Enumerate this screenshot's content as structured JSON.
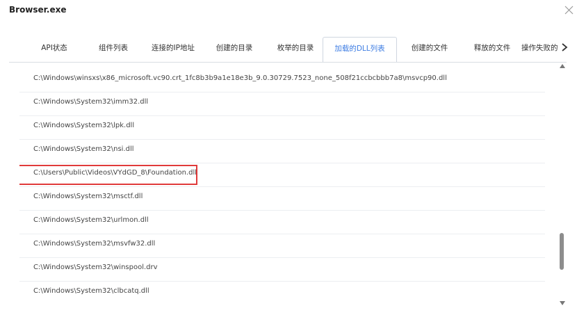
{
  "window": {
    "title": "Browser.exe"
  },
  "tabs": [
    {
      "label": "API状态"
    },
    {
      "label": "组件列表"
    },
    {
      "label": "连接的IP地址"
    },
    {
      "label": "创建的目录"
    },
    {
      "label": "枚举的目录"
    },
    {
      "label": "加载的DLL列表"
    },
    {
      "label": "创建的文件"
    },
    {
      "label": "释放的文件"
    },
    {
      "label": "操作失败的"
    }
  ],
  "active_tab": "加载的DLL列表",
  "dll_list": [
    "C:\\Windows\\winsxs\\x86_microsoft.vc90.crt_1fc8b3b9a1e18e3b_9.0.30729.7523_none_508f21ccbcbbb7a8\\msvcp90.dll",
    "C:\\Windows\\System32\\imm32.dll",
    "C:\\Windows\\System32\\lpk.dll",
    "C:\\Windows\\System32\\nsi.dll",
    "C:\\Users\\Public\\Videos\\VYdGD_8\\Foundation.dll",
    "C:\\Windows\\System32\\msctf.dll",
    "C:\\Windows\\System32\\urlmon.dll",
    "C:\\Windows\\System32\\msvfw32.dll",
    "C:\\Windows\\System32\\winspool.drv",
    "C:\\Windows\\System32\\clbcatq.dll"
  ],
  "highlighted_item": "C:\\Users\\Public\\Videos\\VYdGD_8\\Foundation.dll",
  "icons": {
    "close": "close-icon",
    "tab_next": "chevron-right-icon",
    "scroll_up": "caret-up-icon",
    "scroll_down": "caret-down-icon"
  },
  "colors": {
    "active_tab_text": "#3e7de3",
    "highlight_border": "#e03a3a"
  }
}
